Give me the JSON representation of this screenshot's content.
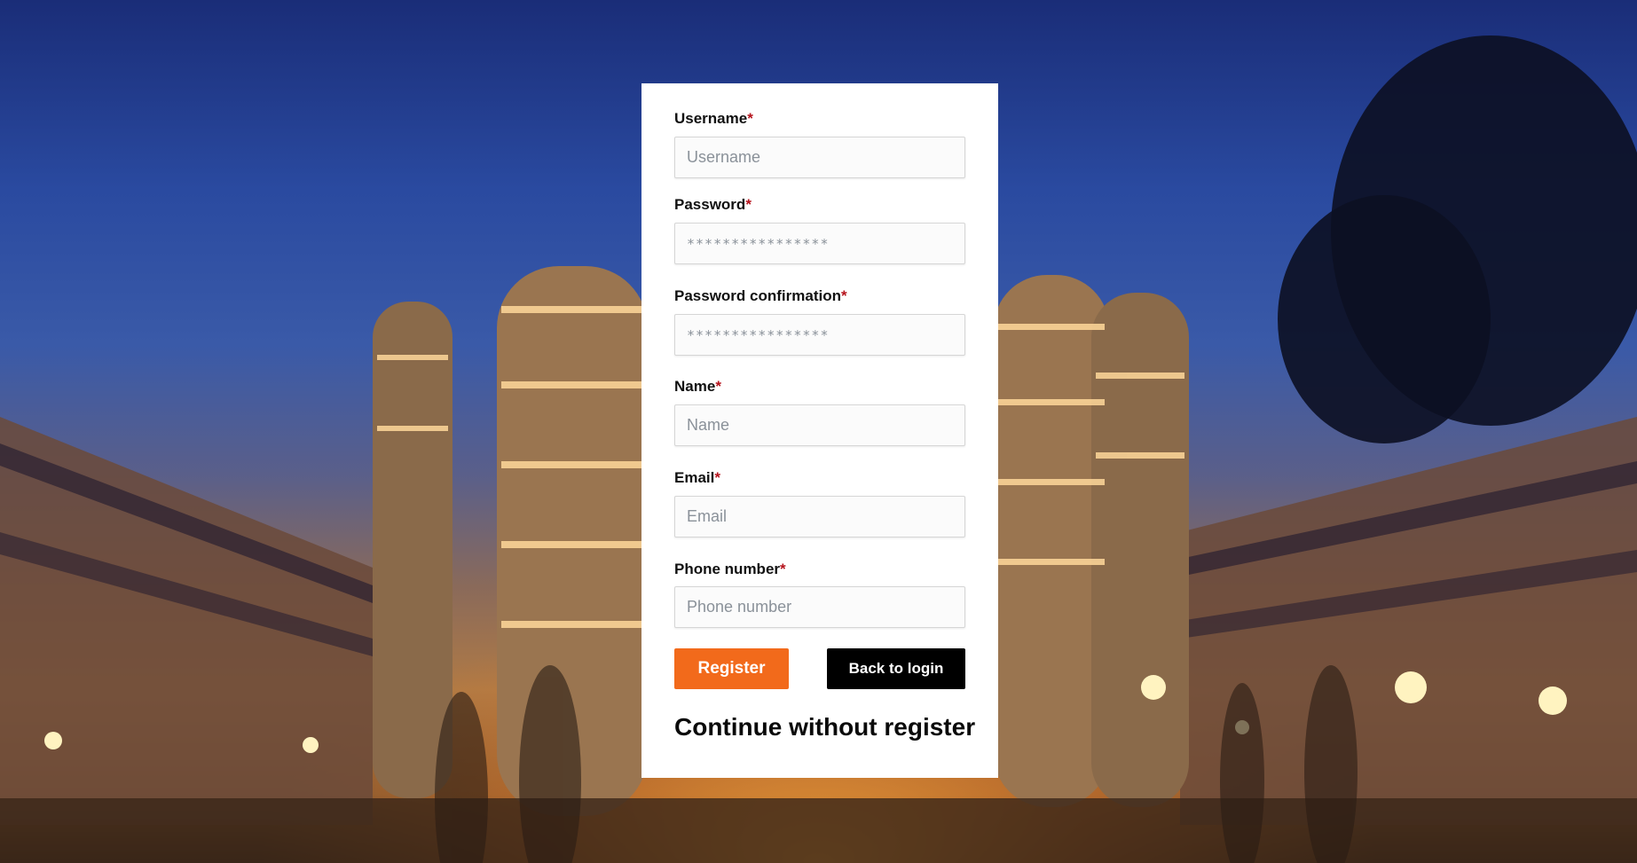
{
  "form": {
    "fields": [
      {
        "label": "Username",
        "required_mark": "*",
        "placeholder": "Username",
        "value": ""
      },
      {
        "label": "Password",
        "required_mark": "*",
        "placeholder": "****************",
        "value": ""
      },
      {
        "label": "Password confirmation",
        "required_mark": "*",
        "placeholder": "****************",
        "value": ""
      },
      {
        "label": "Name",
        "required_mark": "*",
        "placeholder": "Name",
        "value": ""
      },
      {
        "label": "Email",
        "required_mark": "*",
        "placeholder": "Email",
        "value": ""
      },
      {
        "label": "Phone number",
        "required_mark": "*",
        "placeholder": "Phone number",
        "value": ""
      }
    ],
    "register_label": "Register",
    "back_label": "Back to login",
    "continue_label": "Continue without register"
  },
  "colors": {
    "accent": "#f26a1b",
    "required": "#b5121b",
    "secondary_button": "#000000"
  },
  "background": {
    "description_icon": "campus-night-photo"
  }
}
